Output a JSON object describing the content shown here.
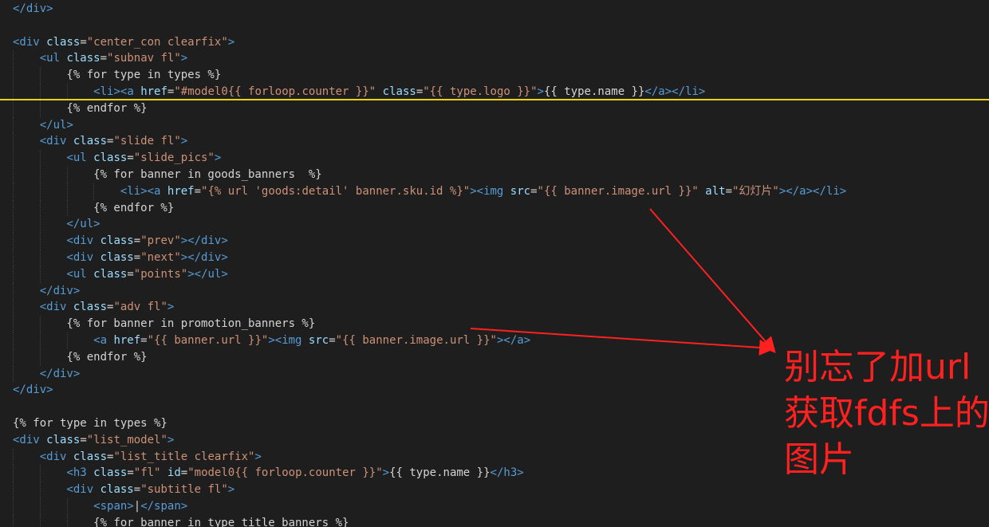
{
  "editor": {
    "lines": [
      "</div>",
      "",
      "<div class=\"center_con clearfix\">",
      "    <ul class=\"subnav fl\">",
      "        {% for type in types %}",
      "            <li><a href=\"#model0{{ forloop.counter }}\" class=\"{{ type.logo }}\">{{ type.name }}</a></li>",
      "        {% endfor %}",
      "    </ul>",
      "    <div class=\"slide fl\">",
      "        <ul class=\"slide_pics\">",
      "            {% for banner in goods_banners  %}",
      "                <li><a href=\"{% url 'goods:detail' banner.sku.id %}\"><img src=\"{{ banner.image.url }}\" alt=\"幻灯片\"></a></li>",
      "            {% endfor %}",
      "        </ul>",
      "        <div class=\"prev\"></div>",
      "        <div class=\"next\"></div>",
      "        <ul class=\"points\"></ul>",
      "    </div>",
      "    <div class=\"adv fl\">",
      "        {% for banner in promotion_banners %}",
      "            <a href=\"{{ banner.url }}\"><img src=\"{{ banner.image.url }}\"></a>",
      "        {% endfor %}",
      "    </div>",
      "</div>",
      "",
      "{% for type in types %}",
      "<div class=\"list_model\">",
      "    <div class=\"list_title clearfix\">",
      "        <h3 class=\"fl\" id=\"model0{{ forloop.counter }}\">{{ type.name }}</h3>",
      "        <div class=\"subtitle fl\">",
      "            <span>|</span>",
      "            {% for banner in type_title_banners %}"
    ]
  },
  "annotation": {
    "line1": "别忘了加url",
    "line2": "获取fdfs上的",
    "line3": "图片"
  },
  "colors": {
    "background": "#1e1e1e",
    "tag": "#569cd6",
    "attribute": "#9cdcfe",
    "string": "#ce9178",
    "text": "#d4d4d4",
    "annotation": "#ff2020",
    "cursor_line": "#e6d20f"
  }
}
